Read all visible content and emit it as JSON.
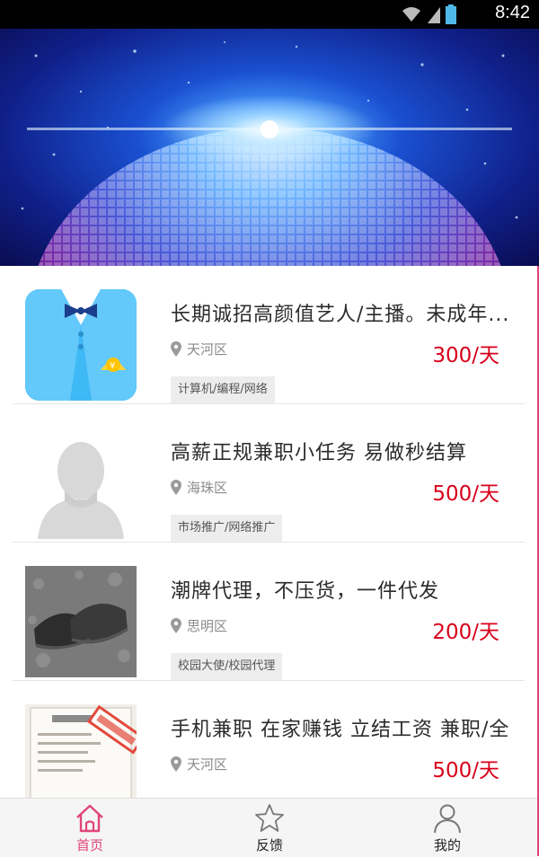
{
  "status_bar": {
    "time": "8:42"
  },
  "listings": [
    {
      "title": "长期诚招高颜值艺人/主播。未成年...",
      "location": "天河区",
      "price": "300/天",
      "tag": "计算机/编程/网络",
      "thumb_icon": "suit-icon"
    },
    {
      "title": "高薪正规兼职小任务 易做秒结算",
      "location": "海珠区",
      "price": "500/天",
      "tag": "市场推广/网络推广",
      "thumb_icon": "avatar-placeholder-icon"
    },
    {
      "title": "潮牌代理，不压货，一件代发",
      "location": "思明区",
      "price": "200/天",
      "tag": "校园大使/校园代理",
      "thumb_icon": "sneakers-photo"
    },
    {
      "title": "手机兼职 在家赚钱 立结工资 兼职/全",
      "location": "天河区",
      "price": "500/天",
      "tag": "",
      "thumb_icon": "business-license-photo"
    }
  ],
  "tabs": [
    {
      "label": "首页",
      "icon": "home-icon",
      "active": true
    },
    {
      "label": "反馈",
      "icon": "star-icon",
      "active": false
    },
    {
      "label": "我的",
      "icon": "person-icon",
      "active": false
    }
  ],
  "colors": {
    "accent": "#e0457a",
    "price": "#d8001b"
  }
}
